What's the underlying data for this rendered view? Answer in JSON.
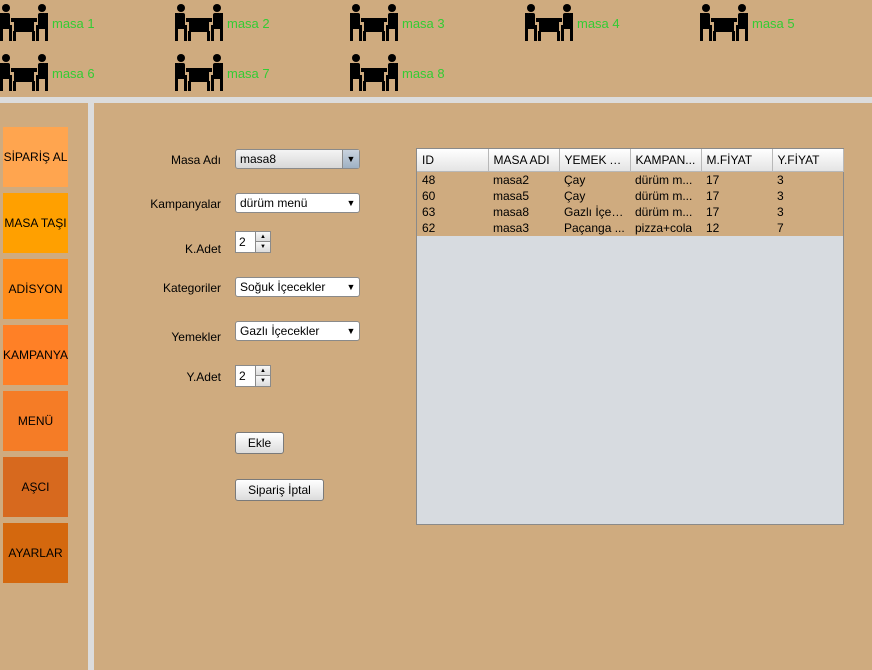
{
  "tables": [
    {
      "name": "masa 1"
    },
    {
      "name": "masa 2"
    },
    {
      "name": "masa 3"
    },
    {
      "name": "masa 4"
    },
    {
      "name": "masa 5"
    },
    {
      "name": "masa 6"
    },
    {
      "name": "masa 7"
    },
    {
      "name": "masa 8"
    }
  ],
  "menu": {
    "items": [
      {
        "label": "SİPARİŞ AL",
        "color": "#ffa54f"
      },
      {
        "label": "MASA TAŞI",
        "color": "#ffa000"
      },
      {
        "label": "ADİSYON",
        "color": "#ff8c1a"
      },
      {
        "label": "KAMPANYA",
        "color": "#ff8026"
      },
      {
        "label": "MENÜ",
        "color": "#f57c26"
      },
      {
        "label": "AŞCI",
        "color": "#d7691e"
      },
      {
        "label": "AYARLAR",
        "color": "#d4680e"
      }
    ]
  },
  "form": {
    "masa_adi_label": "Masa Adı",
    "masa_adi_value": "masa8",
    "kampanyalar_label": "Kampanyalar",
    "kampanyalar_value": "dürüm menü",
    "k_adet_label": "K.Adet",
    "k_adet_value": "2",
    "kategoriler_label": "Kategoriler",
    "kategoriler_value": "Soğuk İçecekler",
    "yemekler_label": "Yemekler",
    "yemekler_value": "Gazlı İçecekler",
    "y_adet_label": "Y.Adet",
    "y_adet_value": "2",
    "add_label": "Ekle",
    "cancel_label": "Sipariş İptal"
  },
  "orders": {
    "columns": [
      "ID",
      "MASA ADI",
      "YEMEK A...",
      "KAMPAN...",
      "M.FİYAT",
      "Y.FİYAT"
    ],
    "rows": [
      [
        "48",
        "masa2",
        "Çay",
        "dürüm m...",
        "17",
        "3"
      ],
      [
        "60",
        "masa5",
        "Çay",
        "dürüm m...",
        "17",
        "3"
      ],
      [
        "63",
        "masa8",
        "Gazlı İçec...",
        "dürüm m...",
        "17",
        "3"
      ],
      [
        "62",
        "masa3",
        "Paçanga ...",
        "pizza+cola",
        "12",
        "7"
      ]
    ]
  },
  "colors": {
    "background": "#cfab7f",
    "table_label": "#33cc33",
    "separator": "#dcdcdc",
    "grid_empty": "#d7dbe0"
  },
  "icons": {
    "table": "dining-table-icon",
    "dropdown": "chevron-down-icon",
    "spinner_up": "caret-up-icon",
    "spinner_down": "caret-down-icon"
  }
}
